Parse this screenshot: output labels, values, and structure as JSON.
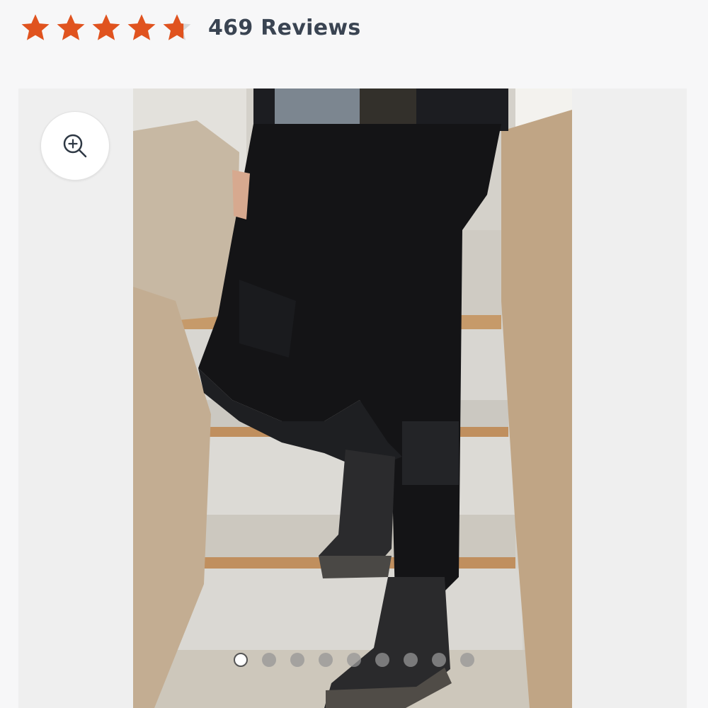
{
  "rating": {
    "stars": 4.5,
    "max_stars": 5,
    "star_color": "#e0531f",
    "review_count_label": "469 Reviews"
  },
  "gallery": {
    "zoom_icon": "zoom-in-icon",
    "image_description_icon": "product-photo",
    "slide_count": 9,
    "active_slide": 1
  }
}
